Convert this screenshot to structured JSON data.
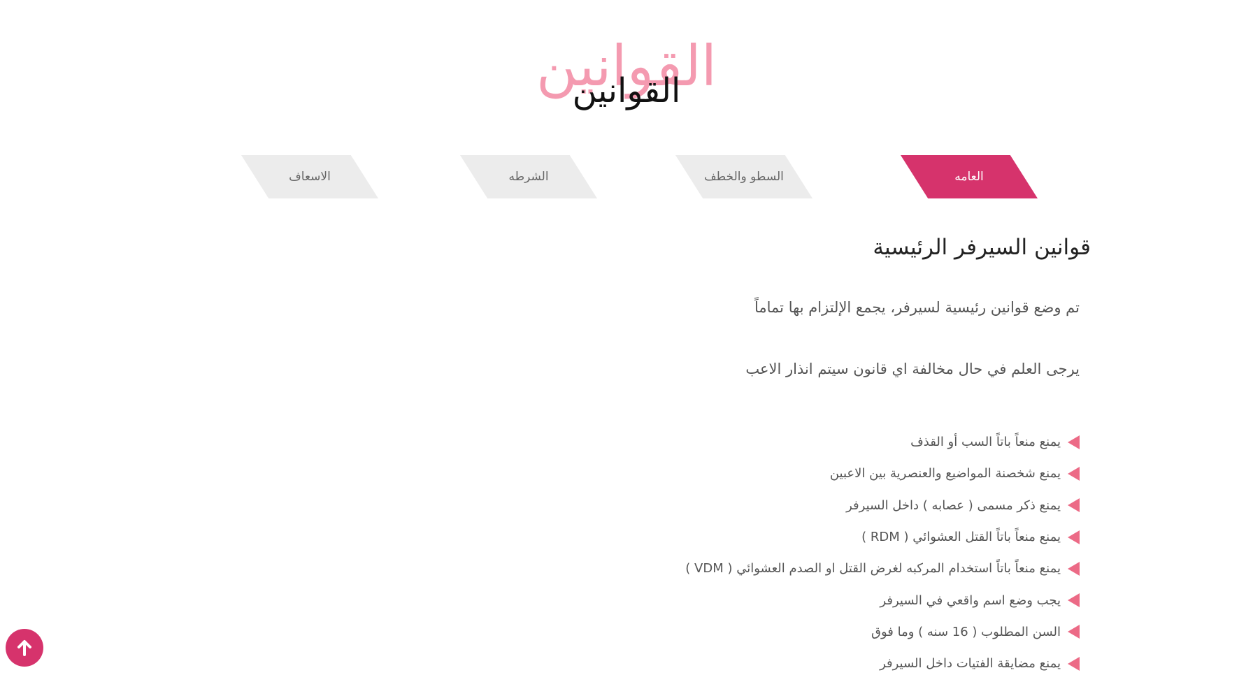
{
  "header": {
    "title_bg": "القوانين",
    "title": "القوانين"
  },
  "tabs": [
    {
      "label": "العامه",
      "active": true
    },
    {
      "label": "السطو والخطف",
      "active": false
    },
    {
      "label": "الشرطه",
      "active": false
    },
    {
      "label": "الاسعاف",
      "active": false
    }
  ],
  "section": {
    "title": "قوانين السيرفر الرئيسية",
    "paragraphs": [
      "تم وضع قوانين رئيسية لسيرفر، يجمع الإلتزام بها تماماً",
      "يرجى العلم في حال مخالفة اي قانون سيتم انذار الاعب"
    ],
    "rules": [
      "يمنع منعاً باتاً السب أو القذف",
      "يمنع شخصنة المواضيع والعنصرية بين الاعبين",
      "يمنع ذكر مسمى ( عصابه ) داخل السيرفر",
      "يمنع منعاً باتاً القتل العشوائي ( RDM )",
      "يمنع منعاً باتاً استخدام المركبه لغرض القتل او الصدم العشوائي ( VDM )",
      "يجب وضع اسم واقعي في السيرفر",
      "السن المطلوب ( 16 سنه ) وما فوق",
      "يمنع مضايقة الفتيات داخل السيرفر"
    ]
  },
  "colors": {
    "accent": "#d6336c",
    "title_bg": "#f49ab0",
    "bullet": "#ec6a86",
    "tab_inactive": "#ececec"
  },
  "icons": {
    "rule_bullet": "triangle-left-icon",
    "back_to_top": "arrow-up-icon"
  }
}
